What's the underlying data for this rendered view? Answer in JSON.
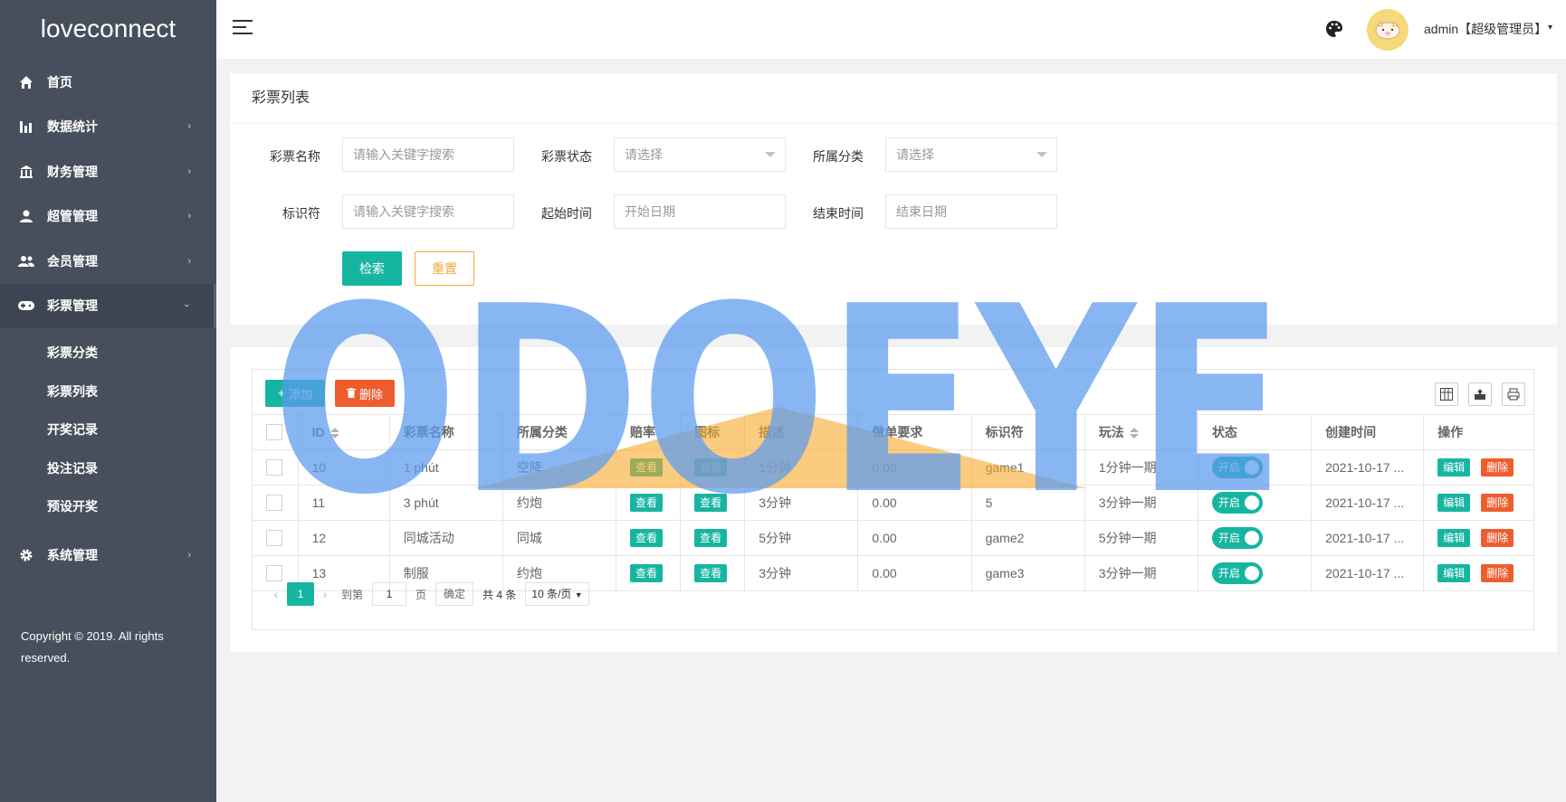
{
  "sidebar": {
    "logo": "loveconnect",
    "items": [
      {
        "label": "首页",
        "icon": "home-icon",
        "chevron": ""
      },
      {
        "label": "数据统计",
        "icon": "bar-chart-icon",
        "chevron": "›"
      },
      {
        "label": "财务管理",
        "icon": "bank-icon",
        "chevron": "›"
      },
      {
        "label": "超管管理",
        "icon": "user-icon",
        "chevron": "›"
      },
      {
        "label": "会员管理",
        "icon": "group-icon",
        "chevron": "›"
      },
      {
        "label": "彩票管理",
        "icon": "gamepad-icon",
        "chevron": "›"
      }
    ],
    "subitems": [
      "彩票分类",
      "彩票列表",
      "开奖记录",
      "投注记录",
      "预设开奖"
    ],
    "system": {
      "label": "系统管理",
      "icon": "gear-icon",
      "chevron": "›"
    },
    "copyright": "Copyright © 2019. All rights reserved."
  },
  "header": {
    "user": "admin【超级管理员】",
    "caret": "▾"
  },
  "search_card": {
    "title": "彩票列表",
    "fields": [
      {
        "label": "彩票名称",
        "placeholder": "请输入关键字搜索"
      },
      {
        "label": "彩票状态",
        "placeholder": "请选择"
      },
      {
        "label": "所属分类",
        "placeholder": "请选择"
      },
      {
        "label": "标识符",
        "placeholder": "请输入关键字搜索"
      },
      {
        "label": "起始时间",
        "placeholder": "开始日期"
      },
      {
        "label": "结束时间",
        "placeholder": "结束日期"
      }
    ],
    "search_btn": "检索",
    "reset_btn": "重置"
  },
  "table": {
    "add_btn": "添加",
    "del_btn": "删除",
    "columns": [
      "ID",
      "彩票名称",
      "所属分类",
      "赔率",
      "图标",
      "描述",
      "做单要求",
      "标识符",
      "玩法",
      "状态",
      "创建时间",
      "操作"
    ],
    "view_label": "查看",
    "switch_label": "开启",
    "edit_label": "编辑",
    "delete_label": "删除",
    "rows": [
      {
        "id": "10",
        "name": "1 phút",
        "category": "空降",
        "desc": "1分钟",
        "req": "0.00",
        "code": "game1",
        "play": "1分钟一期",
        "created": "2021-10-17 ..."
      },
      {
        "id": "11",
        "name": "3 phút",
        "category": "约炮",
        "desc": "3分钟",
        "req": "0.00",
        "code": "5",
        "play": "3分钟一期",
        "created": "2021-10-17 ..."
      },
      {
        "id": "12",
        "name": "同城活动",
        "category": "同城",
        "desc": "5分钟",
        "req": "0.00",
        "code": "game2",
        "play": "5分钟一期",
        "created": "2021-10-17 ..."
      },
      {
        "id": "13",
        "name": "制服",
        "category": "约炮",
        "desc": "3分钟",
        "req": "0.00",
        "code": "game3",
        "play": "3分钟一期",
        "created": "2021-10-17 ..."
      }
    ]
  },
  "pager": {
    "current": "1",
    "goto_label": "到第",
    "goto_value": "1",
    "page_unit": "页",
    "confirm": "确定",
    "total": "共 4 条",
    "per_page": "10 条/页"
  },
  "watermark": {
    "text": "ODOEYE",
    "color": "#5b9bef"
  },
  "colors": {
    "accent": "#16b5a1",
    "danger": "#ee5d2e",
    "warning": "#f1a93a",
    "sidebar": "#484f5c"
  }
}
